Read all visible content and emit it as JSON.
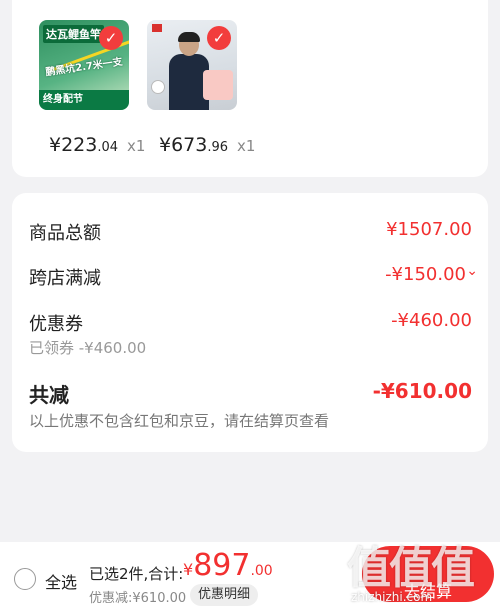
{
  "products": [
    {
      "thumb_title": "达瓦鲤鱼竿",
      "thumb_text": "鹏黑坑2.7米一支",
      "thumb_footer": "终身配节",
      "price_int": "¥223",
      "price_dec": ".04",
      "qty": "x1"
    },
    {
      "price_int": "¥673",
      "price_dec": ".96",
      "qty": "x1"
    }
  ],
  "summary": {
    "goods_total_label": "商品总额",
    "goods_total_value": "¥1507.00",
    "cross_store_label": "跨店满减",
    "cross_store_value": "-¥150.00",
    "coupon_label": "优惠券",
    "coupon_value": "-¥460.00",
    "coupon_sub": "已领券 -¥460.00",
    "total_reduce_label": "共减",
    "total_reduce_value": "-¥610.00",
    "note": "以上优惠不包含红包和京豆，请在结算页查看"
  },
  "bottom": {
    "select_all": "全选",
    "selected_info": "已选2件,合计:",
    "total_cur": "¥",
    "total_int": "897",
    "total_dec": ".00",
    "discount_line": "优惠减:¥610.00",
    "detail_button": "优惠明细",
    "checkout_button": "去结算"
  },
  "watermark": {
    "glyphs": "值值值",
    "site": "zhizhizhi.com"
  },
  "colors": {
    "accent_red": "#f23030",
    "background": "#f2f2f4"
  },
  "icons": {
    "checkmark": "checkmark-icon",
    "chevron": "chevron-down-icon",
    "radio": "radio-unchecked-icon"
  }
}
